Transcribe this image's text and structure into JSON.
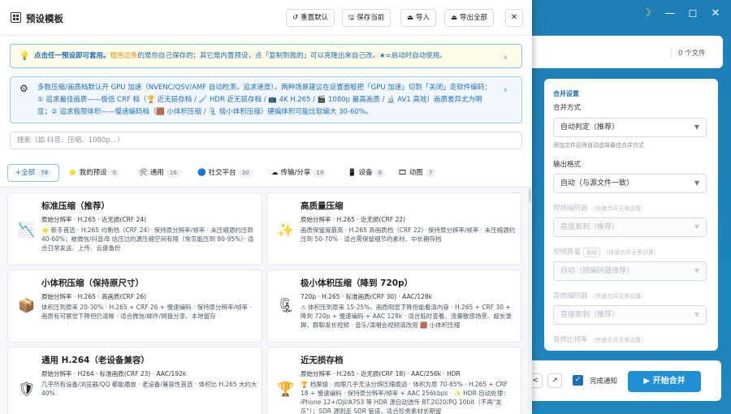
{
  "app": {
    "controls": {
      "theme_icon": "☽",
      "minimize": "—",
      "maximize": "☐",
      "close": "✕"
    },
    "file_count": "0 个文件",
    "settings": {
      "section_title": "合并设置",
      "merge_method_label": "合并方式",
      "merge_method_value": "自动判定（推荐）",
      "merge_hint": "添加文件后将自动选择最佳合并方式",
      "output_format_label": "输出格式",
      "output_format_value": "自动（与源文件一致）",
      "video_encoder_label": "视频编码器",
      "video_encoder_note": "（快速合并无需设置）",
      "video_encoder_value": "直接复制（推荐）",
      "video_quality_label": "视频质量",
      "video_quality_tag": "自动",
      "video_quality_note": "（快速合并无需设置）",
      "video_quality_value": "自动（按编码器推荐）",
      "audio_encoder_label": "音频编码器",
      "audio_encoder_note": "（快速合并无需设置）",
      "audio_encoder_value": "直接复制（推荐）",
      "audio_bitrate_label": "音频比特率",
      "audio_bitrate_note": "（快速合并无需设置）"
    },
    "bottom": {
      "expand_icon": "↗",
      "notify_label": "完成通知",
      "start_label": "▶ 开始合并"
    }
  },
  "modal": {
    "title": "预设模板",
    "buttons": {
      "reset": "重置默认",
      "reset_icon": "↺",
      "save": "保存当前",
      "save_icon": "🖫",
      "import": "导入",
      "import_icon": "⏏",
      "export": "导出全部",
      "export_icon": "⏏",
      "close": "✕"
    },
    "notice1": {
      "icon": "💡",
      "bold": "点击任一预设即可套用。",
      "orange": "橙色边条",
      "rest": "的是你自己保存的；其它是内置预设，点「复制到我的」可以克隆出来自己改。★=启动时自动使用。",
      "close": "x"
    },
    "notice2": {
      "icon": "⚙",
      "text": "多数压缩/画质档默认开 GPU 加速（NVENC/QSV/AMF 自动检测，追求速度）。两种场景建议在设置面板把「GPU 加速」切到「关闭」走软件编码：① 追求最佳画质——极低 CRF 档（🏆 近无损存档 / 🖌 HDR 近无损存档 / 📺 4K H.265 / 🎬 1080p 最高画质 / 🔬 AV1 高效）画质差异尤为明显；② 追求极限体积——慢速编码档（🟫 小体积压缩 / 🗜 极小体积压缩）硬编体积可能比软编大 30-60%。",
      "close": "x"
    },
    "search_placeholder": "搜索（如 抖音、压缩、1080p…）",
    "tabs": [
      {
        "icon": "+",
        "label": "全部",
        "count": "78"
      },
      {
        "icon": "⭐",
        "label": "我的预设",
        "count": "0"
      },
      {
        "icon": "🛠",
        "label": "通用",
        "count": "16"
      },
      {
        "icon": "🔵",
        "label": "社交平台",
        "count": "30"
      },
      {
        "icon": "☁",
        "label": "传输/分享",
        "count": "19"
      },
      {
        "icon": "📱",
        "label": "设备",
        "count": "6"
      },
      {
        "icon": "🎞",
        "label": "动图",
        "count": "7"
      }
    ],
    "presets": [
      {
        "icon": "📉",
        "title": "标准压缩（推荐）",
        "meta": "原始分辨率 · H.265 · 近无损(CRF 24)",
        "desc": "⭐ 新手首选 · H.265 均衡档（CRF 24）· 保持原分辨率/帧率 · 未压缩源约压到 40-60%；被微信/抖音/B 站压过的源压缩空间有限（常见能压到 80-95%）· 适合日常发送、上传、云盘备份"
      },
      {
        "icon": "✨",
        "title": "高质量压缩",
        "meta": "原始分辨率 · H.265 · 近无损(CRF 22)",
        "desc": "画质保留度最高 · H.265 高画质档（CRF 22）· 保持原分辨率/帧率 · 未压缩源约压到 50-70% · 适合需保留细节的素材、中长期存档"
      },
      {
        "icon": "📦",
        "title": "小体积压缩（保持原尺寸）",
        "meta": "原始分辨率 · H.265 · 高画质(CRF 26)",
        "desc": "体积压到原来 20-30% · H.265 + CRF 26 + 慢速编码 · 保持原分辨率/帧率 · 画质有可察觉下降但仍清晰 · 适合微信/邮件/网盘分享、本地留存"
      },
      {
        "icon": "🗜",
        "title": "极小体积压缩（降到 720p）",
        "meta": "720p · H.265 · 标准画质(CRF 30) · AAC/128k",
        "desc": "⚠ 体积压到原来 15-25%，画质明显下降但能看清内容 · H.265 + CRF 30 + 降到 720p + 慢速编码 + AAC 128k · 适合临时查看、流量敏感场景、超长录屏、群聊发长视频 · 音乐/演唱会视频请改用 🟫 小体积压缩"
      },
      {
        "icon": "🛡",
        "title": "通用 H.264（老设备兼容）",
        "meta": "原始分辨率 · H264 · 标准画质(CRF 23) · AAC/192k",
        "desc": "几乎所有设备/浏览器/QQ 都能播放 · 老设备/兼容性首选 · 体积比 H.265 大约大 40%"
      },
      {
        "icon": "🏆",
        "title": "近无损存档",
        "meta": "原始分辨率 · H.265 · 近无损(CRF 18) · AAC/256k · HDR",
        "desc": "🏆 档案级 · 肉眼几乎无法分辨压缩痕迹 · 体积为原 70-85% · H.265 + CRF 18 + 慢速编码 · 保持原分辨率/帧率 + AAC 256kbps · ✨ HDR 自动处理：iPhone 12+/DJI/A7S3 等 HDR 源自动透传 BT.2020/PQ 10bit（不再\"发灰\"）；SDR 源则走 SDR 管道，适合珍贵素材长期留"
      }
    ]
  }
}
